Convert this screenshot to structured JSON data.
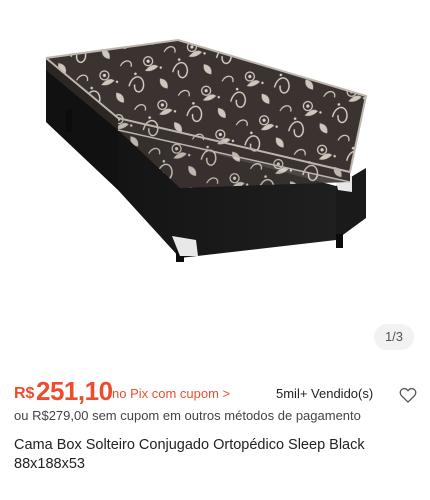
{
  "gallery": {
    "page_indicator": "1/3"
  },
  "price": {
    "currency": "R$",
    "value": "251,10",
    "pix_link": "no Pix com cupom >",
    "sold": "5mil+ Vendido(s)",
    "heart_icon": "heart-outline-icon",
    "accent_color": "#ee4d2d"
  },
  "alt_price": "ou R$279,00 sem cupom em outros métodos de pagamento",
  "product": {
    "title": "Cama Box Solteiro Conjugado Ortopédico Sleep Black 88x188x53"
  }
}
